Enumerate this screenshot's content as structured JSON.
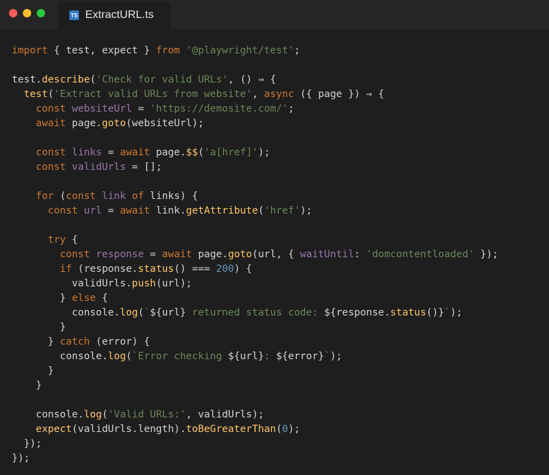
{
  "window": {
    "tab": {
      "icon": "typescript-file-icon",
      "icon_text": "TS",
      "filename": "ExtractURL.ts"
    }
  },
  "colors": {
    "background": "#1e1e1e",
    "titlebar": "#252526",
    "close_dot": "#ff5f57",
    "minimize_dot": "#febc2e",
    "maximize_dot": "#28c840",
    "keyword": "#cc7832",
    "string": "#6a8759",
    "number": "#6897bb",
    "function": "#ffc66d",
    "variable": "#9876aa",
    "text": "#d4d4d4"
  },
  "code_lines": [
    [
      {
        "t": "import",
        "c": "kw"
      },
      {
        "t": " { test, expect } ",
        "c": "plain"
      },
      {
        "t": "from",
        "c": "kw"
      },
      {
        "t": " ",
        "c": "plain"
      },
      {
        "t": "'@playwright/test'",
        "c": "str"
      },
      {
        "t": ";",
        "c": "plain"
      }
    ],
    [],
    [
      {
        "t": "test.",
        "c": "plain"
      },
      {
        "t": "describe",
        "c": "fn"
      },
      {
        "t": "(",
        "c": "plain"
      },
      {
        "t": "'Check for valid URLs'",
        "c": "str"
      },
      {
        "t": ", () ⇒ {",
        "c": "plain"
      }
    ],
    [
      {
        "t": "  ",
        "c": "plain"
      },
      {
        "t": "test",
        "c": "fn"
      },
      {
        "t": "(",
        "c": "plain"
      },
      {
        "t": "'Extract valid URLs from website'",
        "c": "str"
      },
      {
        "t": ", ",
        "c": "plain"
      },
      {
        "t": "async",
        "c": "kw"
      },
      {
        "t": " ({ page }) ⇒ {",
        "c": "plain"
      }
    ],
    [
      {
        "t": "    ",
        "c": "plain"
      },
      {
        "t": "const",
        "c": "kw"
      },
      {
        "t": " ",
        "c": "plain"
      },
      {
        "t": "websiteUrl",
        "c": "var"
      },
      {
        "t": " = ",
        "c": "plain"
      },
      {
        "t": "'https://demosite.com/'",
        "c": "str"
      },
      {
        "t": ";",
        "c": "plain"
      }
    ],
    [
      {
        "t": "    ",
        "c": "plain"
      },
      {
        "t": "await",
        "c": "kw"
      },
      {
        "t": " page.",
        "c": "plain"
      },
      {
        "t": "goto",
        "c": "fn"
      },
      {
        "t": "(websiteUrl);",
        "c": "plain"
      }
    ],
    [],
    [
      {
        "t": "    ",
        "c": "plain"
      },
      {
        "t": "const",
        "c": "kw"
      },
      {
        "t": " ",
        "c": "plain"
      },
      {
        "t": "links",
        "c": "var"
      },
      {
        "t": " = ",
        "c": "plain"
      },
      {
        "t": "await",
        "c": "kw"
      },
      {
        "t": " page.",
        "c": "plain"
      },
      {
        "t": "$$",
        "c": "fn"
      },
      {
        "t": "(",
        "c": "plain"
      },
      {
        "t": "'a[href]'",
        "c": "str"
      },
      {
        "t": ");",
        "c": "plain"
      }
    ],
    [
      {
        "t": "    ",
        "c": "plain"
      },
      {
        "t": "const",
        "c": "kw"
      },
      {
        "t": " ",
        "c": "plain"
      },
      {
        "t": "validUrls",
        "c": "var"
      },
      {
        "t": " = [];",
        "c": "plain"
      }
    ],
    [],
    [
      {
        "t": "    ",
        "c": "plain"
      },
      {
        "t": "for",
        "c": "kw"
      },
      {
        "t": " (",
        "c": "plain"
      },
      {
        "t": "const",
        "c": "kw"
      },
      {
        "t": " ",
        "c": "plain"
      },
      {
        "t": "link",
        "c": "var"
      },
      {
        "t": " ",
        "c": "plain"
      },
      {
        "t": "of",
        "c": "kw"
      },
      {
        "t": " links) {",
        "c": "plain"
      }
    ],
    [
      {
        "t": "      ",
        "c": "plain"
      },
      {
        "t": "const",
        "c": "kw"
      },
      {
        "t": " ",
        "c": "plain"
      },
      {
        "t": "url",
        "c": "var"
      },
      {
        "t": " = ",
        "c": "plain"
      },
      {
        "t": "await",
        "c": "kw"
      },
      {
        "t": " link.",
        "c": "plain"
      },
      {
        "t": "getAttribute",
        "c": "fn"
      },
      {
        "t": "(",
        "c": "plain"
      },
      {
        "t": "'href'",
        "c": "str"
      },
      {
        "t": ");",
        "c": "plain"
      }
    ],
    [],
    [
      {
        "t": "      ",
        "c": "plain"
      },
      {
        "t": "try",
        "c": "kw"
      },
      {
        "t": " {",
        "c": "plain"
      }
    ],
    [
      {
        "t": "        ",
        "c": "plain"
      },
      {
        "t": "const",
        "c": "kw"
      },
      {
        "t": " ",
        "c": "plain"
      },
      {
        "t": "response",
        "c": "var"
      },
      {
        "t": " = ",
        "c": "plain"
      },
      {
        "t": "await",
        "c": "kw"
      },
      {
        "t": " page.",
        "c": "plain"
      },
      {
        "t": "goto",
        "c": "fn"
      },
      {
        "t": "(url, { ",
        "c": "plain"
      },
      {
        "t": "waitUntil",
        "c": "var"
      },
      {
        "t": ": ",
        "c": "plain"
      },
      {
        "t": "'domcontentloaded'",
        "c": "str"
      },
      {
        "t": " });",
        "c": "plain"
      }
    ],
    [
      {
        "t": "        ",
        "c": "plain"
      },
      {
        "t": "if",
        "c": "kw"
      },
      {
        "t": " (response.",
        "c": "plain"
      },
      {
        "t": "status",
        "c": "fn"
      },
      {
        "t": "() ",
        "c": "plain"
      },
      {
        "t": "===",
        "c": "plain"
      },
      {
        "t": " ",
        "c": "plain"
      },
      {
        "t": "200",
        "c": "num"
      },
      {
        "t": ") {",
        "c": "plain"
      }
    ],
    [
      {
        "t": "          validUrls.",
        "c": "plain"
      },
      {
        "t": "push",
        "c": "fn"
      },
      {
        "t": "(url);",
        "c": "plain"
      }
    ],
    [
      {
        "t": "        } ",
        "c": "plain"
      },
      {
        "t": "else",
        "c": "kw"
      },
      {
        "t": " {",
        "c": "plain"
      }
    ],
    [
      {
        "t": "          console.",
        "c": "plain"
      },
      {
        "t": "log",
        "c": "fn"
      },
      {
        "t": "(",
        "c": "plain"
      },
      {
        "t": "`",
        "c": "str"
      },
      {
        "t": "${url}",
        "c": "plain"
      },
      {
        "t": " returned status code: ",
        "c": "str"
      },
      {
        "t": "${response.",
        "c": "plain"
      },
      {
        "t": "status",
        "c": "fn"
      },
      {
        "t": "()}",
        "c": "plain"
      },
      {
        "t": "`",
        "c": "str"
      },
      {
        "t": ");",
        "c": "plain"
      }
    ],
    [
      {
        "t": "        }",
        "c": "plain"
      }
    ],
    [
      {
        "t": "      } ",
        "c": "plain"
      },
      {
        "t": "catch",
        "c": "kw"
      },
      {
        "t": " (error) {",
        "c": "plain"
      }
    ],
    [
      {
        "t": "        console.",
        "c": "plain"
      },
      {
        "t": "log",
        "c": "fn"
      },
      {
        "t": "(",
        "c": "plain"
      },
      {
        "t": "`Error checking ",
        "c": "str"
      },
      {
        "t": "${url}",
        "c": "plain"
      },
      {
        "t": ": ",
        "c": "str"
      },
      {
        "t": "${error}",
        "c": "plain"
      },
      {
        "t": "`",
        "c": "str"
      },
      {
        "t": ");",
        "c": "plain"
      }
    ],
    [
      {
        "t": "      }",
        "c": "plain"
      }
    ],
    [
      {
        "t": "    }",
        "c": "plain"
      }
    ],
    [],
    [
      {
        "t": "    console.",
        "c": "plain"
      },
      {
        "t": "log",
        "c": "fn"
      },
      {
        "t": "(",
        "c": "plain"
      },
      {
        "t": "'Valid URLs:'",
        "c": "str"
      },
      {
        "t": ", validUrls);",
        "c": "plain"
      }
    ],
    [
      {
        "t": "    ",
        "c": "plain"
      },
      {
        "t": "expect",
        "c": "fn"
      },
      {
        "t": "(validUrls.length).",
        "c": "plain"
      },
      {
        "t": "toBeGreaterThan",
        "c": "fn"
      },
      {
        "t": "(",
        "c": "plain"
      },
      {
        "t": "0",
        "c": "num"
      },
      {
        "t": ");",
        "c": "plain"
      }
    ],
    [
      {
        "t": "  });",
        "c": "plain"
      }
    ],
    [
      {
        "t": "});",
        "c": "plain"
      }
    ]
  ]
}
